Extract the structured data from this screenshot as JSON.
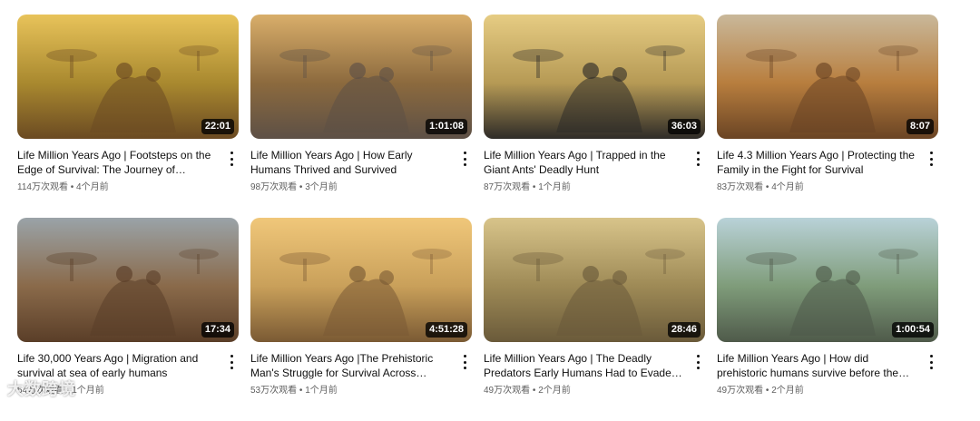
{
  "videos": [
    {
      "title": "Life Million Years Ago | Footsteps on the Edge of Survival: The Journey of Prehistori...",
      "views": "114万次观看",
      "age": "4个月前",
      "duration": "22:01",
      "palette": [
        "#e8c35a",
        "#a9892f",
        "#6b4a22"
      ]
    },
    {
      "title": "Life Million Years Ago | How Early Humans Thrived and Survived",
      "views": "98万次观看",
      "age": "3个月前",
      "duration": "1:01:08",
      "palette": [
        "#d9ae6a",
        "#8c6a3e",
        "#5d5046"
      ]
    },
    {
      "title": "Life Million Years Ago | Trapped in the Giant Ants' Deadly Hunt",
      "views": "87万次观看",
      "age": "1个月前",
      "duration": "36:03",
      "palette": [
        "#e6cc83",
        "#b69a55",
        "#2e2b28"
      ]
    },
    {
      "title": "Life 4.3 Million Years Ago | Protecting the Family in the Fight for Survival",
      "views": "83万次观看",
      "age": "4个月前",
      "duration": "8:07",
      "palette": [
        "#c9b89a",
        "#b87e3e",
        "#6a4424"
      ]
    },
    {
      "title": "Life 30,000 Years Ago | Migration and survival at sea of early humans",
      "views": "54万次观看",
      "age": "1个月前",
      "duration": "17:34",
      "palette": [
        "#9aa3a8",
        "#8a6a4a",
        "#5a3e28"
      ]
    },
    {
      "title": "Life Million Years Ago |The Prehistoric Man's Struggle for Survival Across Millennia",
      "views": "53万次观看",
      "age": "1个月前",
      "duration": "4:51:28",
      "palette": [
        "#f0c77a",
        "#c9a05a",
        "#7a5a34"
      ]
    },
    {
      "title": "Life Million Years Ago | The Deadly Predators Early Humans Had to Evade to...",
      "views": "49万次观看",
      "age": "2个月前",
      "duration": "28:46",
      "palette": [
        "#d8c48a",
        "#9e8a56",
        "#6a5a3a"
      ]
    },
    {
      "title": "Life Million Years Ago | How did prehistoric humans survive before the invention of...",
      "views": "49万次观看",
      "age": "2个月前",
      "duration": "1:00:54",
      "palette": [
        "#b9d2d8",
        "#7f9c7a",
        "#4f5a4a"
      ]
    }
  ],
  "separator": " • ",
  "watermark": "大数跨境"
}
